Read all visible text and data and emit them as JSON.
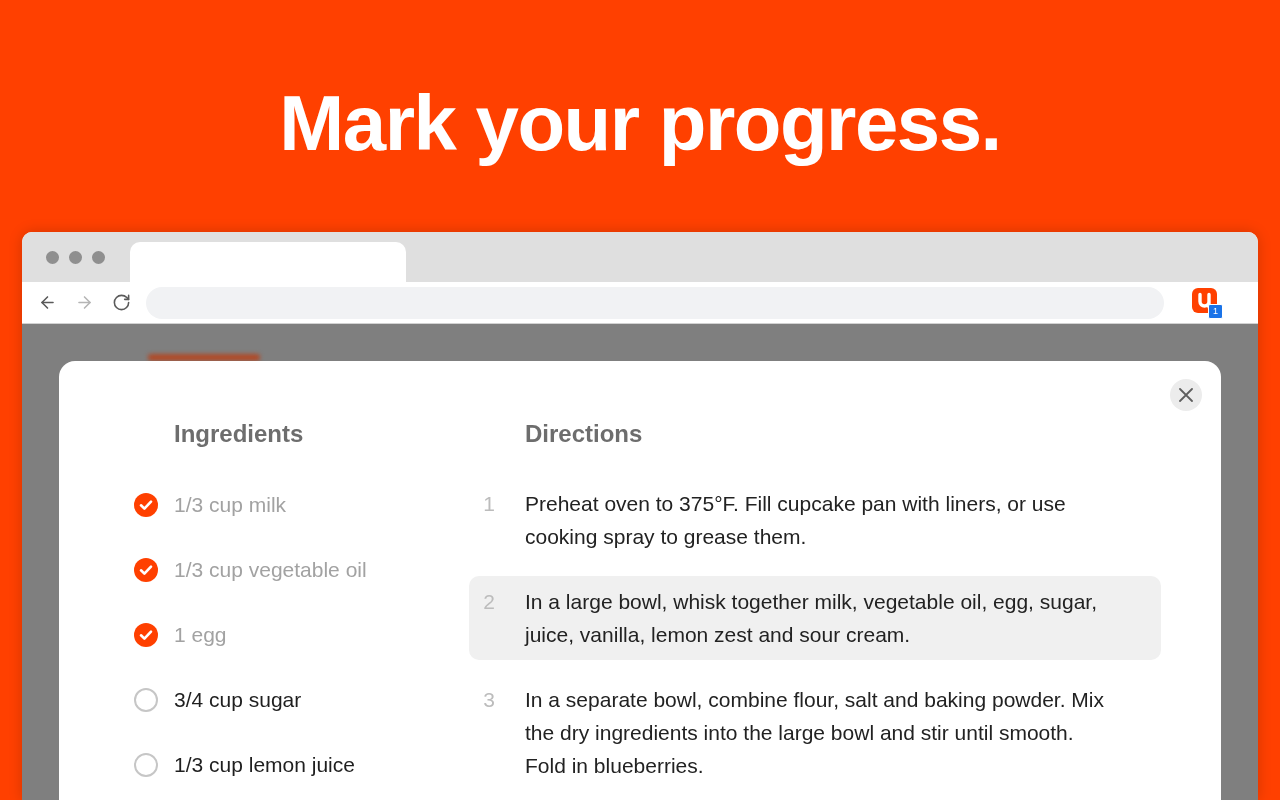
{
  "headline": "Mark your progress.",
  "browser": {
    "nav": [
      {
        "kind": "back",
        "disabled": false
      },
      {
        "kind": "forward",
        "disabled": true
      },
      {
        "kind": "reload",
        "disabled": false
      }
    ],
    "extension": {
      "badge": "1"
    }
  },
  "modal": {
    "ingredients": {
      "title": "Ingredients",
      "items": [
        {
          "text": "1/3 cup milk",
          "checked": true
        },
        {
          "text": "1/3 cup vegetable oil",
          "checked": true
        },
        {
          "text": "1 egg",
          "checked": true
        },
        {
          "text": "3/4 cup sugar",
          "checked": false
        },
        {
          "text": "1/3 cup lemon juice",
          "checked": false
        }
      ]
    },
    "directions": {
      "title": "Directions",
      "steps": [
        {
          "number": "1",
          "text": "Preheat oven to 375°F. Fill cupcake pan with liners, or use cooking spray to grease them.",
          "selected": false
        },
        {
          "number": "2",
          "text": "In a large bowl, whisk together milk, vegetable oil, egg, sugar, juice, vanilla, lemon zest and sour cream.",
          "selected": true
        },
        {
          "number": "3",
          "text": "In a separate bowl, combine flour, salt and baking powder. Mix the dry ingredients into the large bowl and stir until smooth. Fold in blueberries.",
          "selected": false
        }
      ]
    }
  }
}
